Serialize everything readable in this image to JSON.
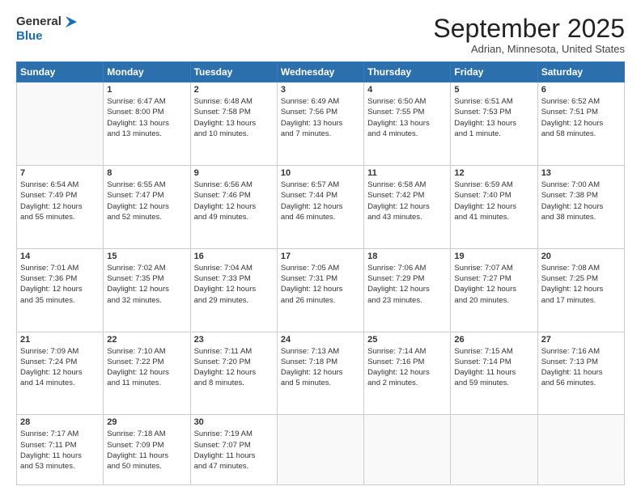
{
  "logo": {
    "text_general": "General",
    "text_blue": "Blue"
  },
  "header": {
    "month": "September 2025",
    "location": "Adrian, Minnesota, United States"
  },
  "weekdays": [
    "Sunday",
    "Monday",
    "Tuesday",
    "Wednesday",
    "Thursday",
    "Friday",
    "Saturday"
  ],
  "weeks": [
    [
      {
        "day": "",
        "info": ""
      },
      {
        "day": "1",
        "info": "Sunrise: 6:47 AM\nSunset: 8:00 PM\nDaylight: 13 hours\nand 13 minutes."
      },
      {
        "day": "2",
        "info": "Sunrise: 6:48 AM\nSunset: 7:58 PM\nDaylight: 13 hours\nand 10 minutes."
      },
      {
        "day": "3",
        "info": "Sunrise: 6:49 AM\nSunset: 7:56 PM\nDaylight: 13 hours\nand 7 minutes."
      },
      {
        "day": "4",
        "info": "Sunrise: 6:50 AM\nSunset: 7:55 PM\nDaylight: 13 hours\nand 4 minutes."
      },
      {
        "day": "5",
        "info": "Sunrise: 6:51 AM\nSunset: 7:53 PM\nDaylight: 13 hours\nand 1 minute."
      },
      {
        "day": "6",
        "info": "Sunrise: 6:52 AM\nSunset: 7:51 PM\nDaylight: 12 hours\nand 58 minutes."
      }
    ],
    [
      {
        "day": "7",
        "info": "Sunrise: 6:54 AM\nSunset: 7:49 PM\nDaylight: 12 hours\nand 55 minutes."
      },
      {
        "day": "8",
        "info": "Sunrise: 6:55 AM\nSunset: 7:47 PM\nDaylight: 12 hours\nand 52 minutes."
      },
      {
        "day": "9",
        "info": "Sunrise: 6:56 AM\nSunset: 7:46 PM\nDaylight: 12 hours\nand 49 minutes."
      },
      {
        "day": "10",
        "info": "Sunrise: 6:57 AM\nSunset: 7:44 PM\nDaylight: 12 hours\nand 46 minutes."
      },
      {
        "day": "11",
        "info": "Sunrise: 6:58 AM\nSunset: 7:42 PM\nDaylight: 12 hours\nand 43 minutes."
      },
      {
        "day": "12",
        "info": "Sunrise: 6:59 AM\nSunset: 7:40 PM\nDaylight: 12 hours\nand 41 minutes."
      },
      {
        "day": "13",
        "info": "Sunrise: 7:00 AM\nSunset: 7:38 PM\nDaylight: 12 hours\nand 38 minutes."
      }
    ],
    [
      {
        "day": "14",
        "info": "Sunrise: 7:01 AM\nSunset: 7:36 PM\nDaylight: 12 hours\nand 35 minutes."
      },
      {
        "day": "15",
        "info": "Sunrise: 7:02 AM\nSunset: 7:35 PM\nDaylight: 12 hours\nand 32 minutes."
      },
      {
        "day": "16",
        "info": "Sunrise: 7:04 AM\nSunset: 7:33 PM\nDaylight: 12 hours\nand 29 minutes."
      },
      {
        "day": "17",
        "info": "Sunrise: 7:05 AM\nSunset: 7:31 PM\nDaylight: 12 hours\nand 26 minutes."
      },
      {
        "day": "18",
        "info": "Sunrise: 7:06 AM\nSunset: 7:29 PM\nDaylight: 12 hours\nand 23 minutes."
      },
      {
        "day": "19",
        "info": "Sunrise: 7:07 AM\nSunset: 7:27 PM\nDaylight: 12 hours\nand 20 minutes."
      },
      {
        "day": "20",
        "info": "Sunrise: 7:08 AM\nSunset: 7:25 PM\nDaylight: 12 hours\nand 17 minutes."
      }
    ],
    [
      {
        "day": "21",
        "info": "Sunrise: 7:09 AM\nSunset: 7:24 PM\nDaylight: 12 hours\nand 14 minutes."
      },
      {
        "day": "22",
        "info": "Sunrise: 7:10 AM\nSunset: 7:22 PM\nDaylight: 12 hours\nand 11 minutes."
      },
      {
        "day": "23",
        "info": "Sunrise: 7:11 AM\nSunset: 7:20 PM\nDaylight: 12 hours\nand 8 minutes."
      },
      {
        "day": "24",
        "info": "Sunrise: 7:13 AM\nSunset: 7:18 PM\nDaylight: 12 hours\nand 5 minutes."
      },
      {
        "day": "25",
        "info": "Sunrise: 7:14 AM\nSunset: 7:16 PM\nDaylight: 12 hours\nand 2 minutes."
      },
      {
        "day": "26",
        "info": "Sunrise: 7:15 AM\nSunset: 7:14 PM\nDaylight: 11 hours\nand 59 minutes."
      },
      {
        "day": "27",
        "info": "Sunrise: 7:16 AM\nSunset: 7:13 PM\nDaylight: 11 hours\nand 56 minutes."
      }
    ],
    [
      {
        "day": "28",
        "info": "Sunrise: 7:17 AM\nSunset: 7:11 PM\nDaylight: 11 hours\nand 53 minutes."
      },
      {
        "day": "29",
        "info": "Sunrise: 7:18 AM\nSunset: 7:09 PM\nDaylight: 11 hours\nand 50 minutes."
      },
      {
        "day": "30",
        "info": "Sunrise: 7:19 AM\nSunset: 7:07 PM\nDaylight: 11 hours\nand 47 minutes."
      },
      {
        "day": "",
        "info": ""
      },
      {
        "day": "",
        "info": ""
      },
      {
        "day": "",
        "info": ""
      },
      {
        "day": "",
        "info": ""
      }
    ]
  ]
}
